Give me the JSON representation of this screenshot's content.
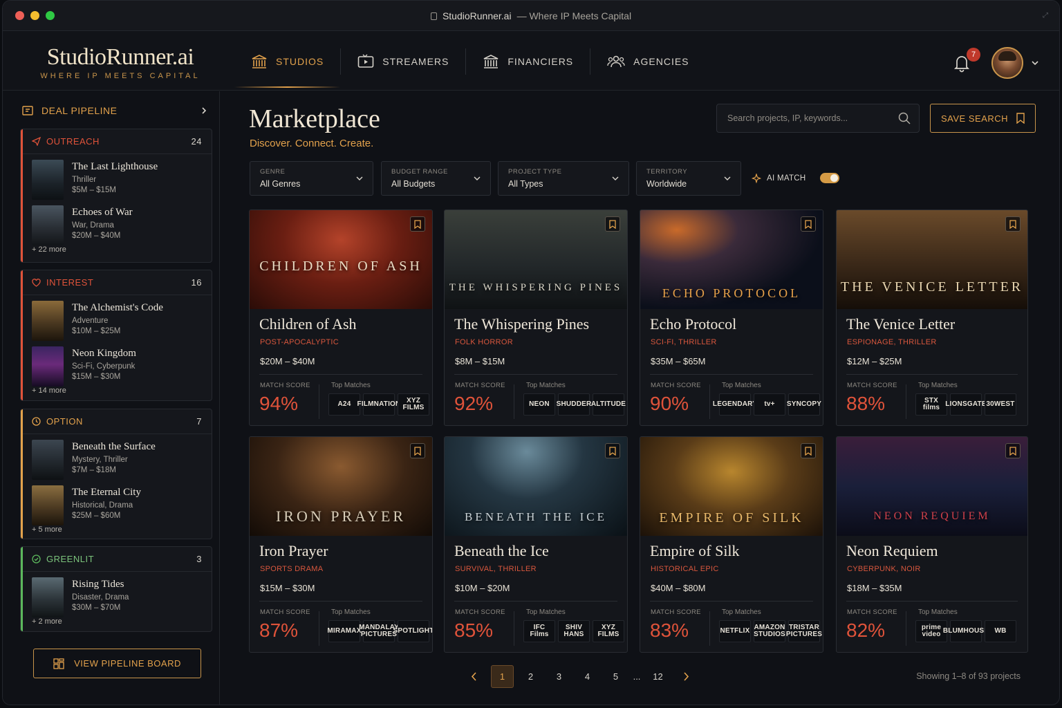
{
  "window": {
    "title": "StudioRunner.ai",
    "title_suffix": "— Where IP Meets Capital"
  },
  "brand": {
    "name": "StudioRunner.ai",
    "tagline": "WHERE IP MEETS CAPITAL"
  },
  "nav": {
    "tabs": [
      {
        "label": "STUDIOS",
        "icon": "building-columns-icon",
        "active": true
      },
      {
        "label": "STREAMERS",
        "icon": "tv-play-icon",
        "active": false
      },
      {
        "label": "FINANCIERS",
        "icon": "bank-icon",
        "active": false
      },
      {
        "label": "AGENCIES",
        "icon": "people-icon",
        "active": false
      }
    ],
    "notifications": "7"
  },
  "sidebar": {
    "title": "DEAL PIPELINE",
    "stages": [
      {
        "name": "OUTREACH",
        "count": "24",
        "color": "#e0533a",
        "icon": "send-icon",
        "more": "+ 22 more",
        "items": [
          {
            "title": "The Last Lighthouse",
            "genre": "Thriller",
            "budget": "$5M – $15M"
          },
          {
            "title": "Echoes of War",
            "genre": "War, Drama",
            "budget": "$20M – $40M"
          }
        ]
      },
      {
        "name": "INTEREST",
        "count": "16",
        "color": "#e0533a",
        "icon": "heart-icon",
        "more": "+ 14 more",
        "items": [
          {
            "title": "The Alchemist's Code",
            "genre": "Adventure",
            "budget": "$10M – $25M"
          },
          {
            "title": "Neon Kingdom",
            "genre": "Sci-Fi, Cyberpunk",
            "budget": "$15M – $30M"
          }
        ]
      },
      {
        "name": "OPTION",
        "count": "7",
        "color": "#e3a24c",
        "icon": "clock-icon",
        "more": "+ 5 more",
        "items": [
          {
            "title": "Beneath the Surface",
            "genre": "Mystery, Thriller",
            "budget": "$7M – $18M"
          },
          {
            "title": "The Eternal City",
            "genre": "Historical, Drama",
            "budget": "$25M – $60M"
          }
        ]
      },
      {
        "name": "GREENLIT",
        "count": "3",
        "color": "#5cb85c",
        "icon": "check-circle-icon",
        "more": "+ 2 more",
        "items": [
          {
            "title": "Rising Tides",
            "genre": "Disaster, Drama",
            "budget": "$30M – $70M"
          }
        ]
      }
    ],
    "board_button": "VIEW PIPELINE BOARD"
  },
  "main": {
    "title": "Marketplace",
    "subtitle": "Discover. Connect. Create.",
    "search_placeholder": "Search projects, IP, keywords...",
    "save_search": "SAVE SEARCH",
    "filters": [
      {
        "label": "GENRE",
        "value": "All Genres"
      },
      {
        "label": "BUDGET RANGE",
        "value": "All Budgets"
      },
      {
        "label": "PROJECT TYPE",
        "value": "All Types"
      },
      {
        "label": "TERRITORY",
        "value": "Worldwide"
      }
    ],
    "ai_match": {
      "label": "AI MATCH",
      "on": true
    },
    "match_score_label": "MATCH SCORE",
    "top_matches_label": "Top Matches",
    "projects": [
      {
        "title": "Children of Ash",
        "poster_text": "CHILDREN OF ASH",
        "genre": "POST-APOCALYPTIC",
        "budget": "$20M – $40M",
        "score": "94%",
        "matches": [
          "A24",
          "FILMNATION",
          "XYZ FILMS"
        ]
      },
      {
        "title": "The Whispering Pines",
        "poster_text": "THE WHISPERING PINES",
        "genre": "FOLK HORROR",
        "budget": "$8M – $15M",
        "score": "92%",
        "matches": [
          "NEON",
          "SHUDDER",
          "ALTITUDE"
        ]
      },
      {
        "title": "Echo Protocol",
        "poster_text": "ECHO PROTOCOL",
        "genre": "SCI-FI, THRILLER",
        "budget": "$35M – $65M",
        "score": "90%",
        "matches": [
          "LEGENDARY",
          "tv+",
          "SYNCOPY"
        ]
      },
      {
        "title": "The Venice Letter",
        "poster_text": "THE VENICE LETTER",
        "genre": "ESPIONAGE, THRILLER",
        "budget": "$12M – $25M",
        "score": "88%",
        "matches": [
          "STX films",
          "LIONSGATE",
          "30WEST"
        ]
      },
      {
        "title": "Iron Prayer",
        "poster_text": "IRON PRAYER",
        "genre": "SPORTS DRAMA",
        "budget": "$15M – $30M",
        "score": "87%",
        "matches": [
          "MIRAMAX",
          "MANDALAY PICTURES",
          "SPOTLIGHT"
        ]
      },
      {
        "title": "Beneath the Ice",
        "poster_text": "BENEATH THE ICE",
        "genre": "SURVIVAL, THRILLER",
        "budget": "$10M – $20M",
        "score": "85%",
        "matches": [
          "IFC Films",
          "SHIV HANS",
          "XYZ FILMS"
        ]
      },
      {
        "title": "Empire of Silk",
        "poster_text": "EMPIRE OF SILK",
        "genre": "HISTORICAL EPIC",
        "budget": "$40M – $80M",
        "score": "83%",
        "matches": [
          "NETFLIX",
          "AMAZON STUDIOS",
          "TRISTAR PICTURES"
        ]
      },
      {
        "title": "Neon Requiem",
        "poster_text": "NEON REQUIEM",
        "genre": "CYBERPUNK, NOIR",
        "budget": "$18M – $35M",
        "score": "82%",
        "matches": [
          "prime video",
          "BLUMHOUSE",
          "WB"
        ]
      }
    ],
    "pagination": {
      "pages": [
        "1",
        "2",
        "3",
        "4",
        "5",
        "...",
        "12"
      ],
      "current": "1",
      "showing": "Showing 1–8 of 93 projects"
    }
  }
}
